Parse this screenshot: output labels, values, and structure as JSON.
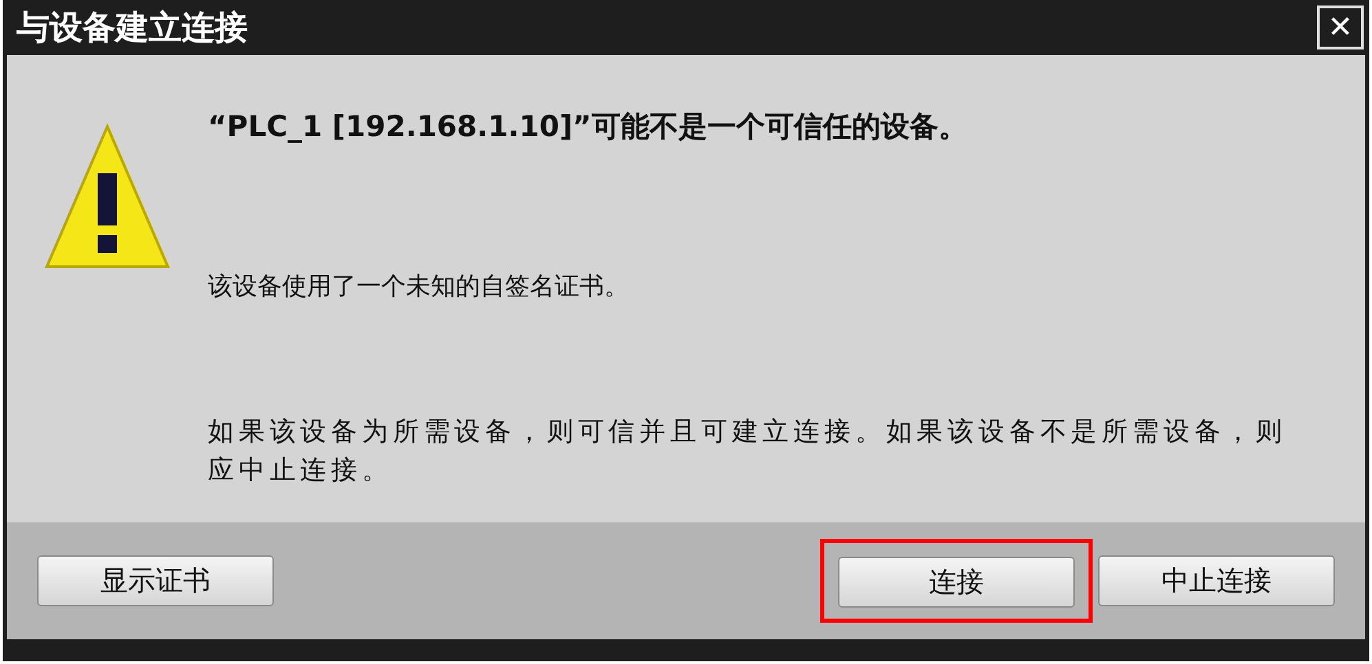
{
  "window": {
    "title": "与设备建立连接",
    "close": "✕"
  },
  "message": {
    "heading": "“PLC_1 [192.168.1.10]”可能不是一个可信任的设备。",
    "detail": "该设备使用了一个未知的自签名证书。",
    "advice": "如果该设备为所需设备，则可信并且可建立连接。如果该设备不是所需设备，则应中止连接。"
  },
  "buttons": [
    {
      "label": "显示证书",
      "highlighted": false
    },
    {
      "label": "连接",
      "highlighted": true
    },
    {
      "label": "中止连接",
      "highlighted": false
    }
  ]
}
